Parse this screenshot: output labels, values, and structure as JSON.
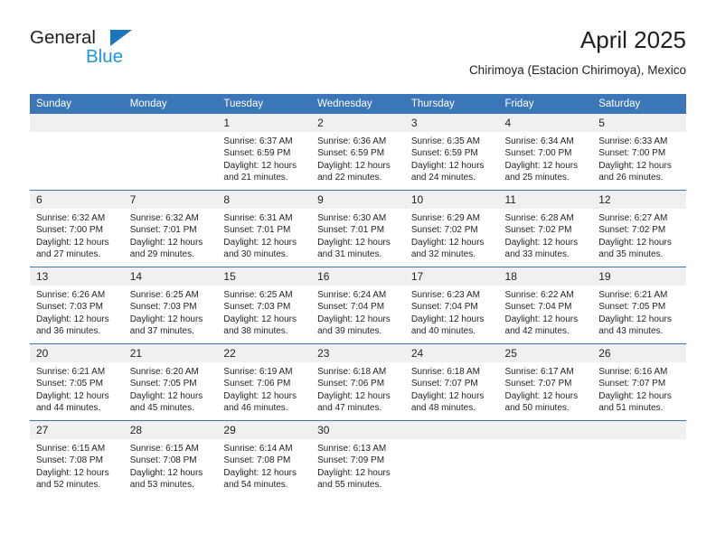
{
  "brand": {
    "name_part1": "General",
    "name_part2": "Blue",
    "accent_color": "#1b75bb",
    "accent_color_light": "#1b9ad6"
  },
  "header": {
    "month_title": "April 2025",
    "location": "Chirimoya (Estacion Chirimoya), Mexico"
  },
  "theme": {
    "header_blue": "#3b76b8",
    "daynum_band": "#f0f0f0"
  },
  "calendar": {
    "weekday_headers": [
      "Sunday",
      "Monday",
      "Tuesday",
      "Wednesday",
      "Thursday",
      "Friday",
      "Saturday"
    ],
    "weeks": [
      [
        {
          "day": "",
          "empty": true,
          "sunrise": "",
          "sunset": "",
          "daylight_line1": "",
          "daylight_line2": ""
        },
        {
          "day": "",
          "empty": true,
          "sunrise": "",
          "sunset": "",
          "daylight_line1": "",
          "daylight_line2": ""
        },
        {
          "day": "1",
          "sunrise": "Sunrise: 6:37 AM",
          "sunset": "Sunset: 6:59 PM",
          "daylight_line1": "Daylight: 12 hours",
          "daylight_line2": "and 21 minutes."
        },
        {
          "day": "2",
          "sunrise": "Sunrise: 6:36 AM",
          "sunset": "Sunset: 6:59 PM",
          "daylight_line1": "Daylight: 12 hours",
          "daylight_line2": "and 22 minutes."
        },
        {
          "day": "3",
          "sunrise": "Sunrise: 6:35 AM",
          "sunset": "Sunset: 6:59 PM",
          "daylight_line1": "Daylight: 12 hours",
          "daylight_line2": "and 24 minutes."
        },
        {
          "day": "4",
          "sunrise": "Sunrise: 6:34 AM",
          "sunset": "Sunset: 7:00 PM",
          "daylight_line1": "Daylight: 12 hours",
          "daylight_line2": "and 25 minutes."
        },
        {
          "day": "5",
          "sunrise": "Sunrise: 6:33 AM",
          "sunset": "Sunset: 7:00 PM",
          "daylight_line1": "Daylight: 12 hours",
          "daylight_line2": "and 26 minutes."
        }
      ],
      [
        {
          "day": "6",
          "sunrise": "Sunrise: 6:32 AM",
          "sunset": "Sunset: 7:00 PM",
          "daylight_line1": "Daylight: 12 hours",
          "daylight_line2": "and 27 minutes."
        },
        {
          "day": "7",
          "sunrise": "Sunrise: 6:32 AM",
          "sunset": "Sunset: 7:01 PM",
          "daylight_line1": "Daylight: 12 hours",
          "daylight_line2": "and 29 minutes."
        },
        {
          "day": "8",
          "sunrise": "Sunrise: 6:31 AM",
          "sunset": "Sunset: 7:01 PM",
          "daylight_line1": "Daylight: 12 hours",
          "daylight_line2": "and 30 minutes."
        },
        {
          "day": "9",
          "sunrise": "Sunrise: 6:30 AM",
          "sunset": "Sunset: 7:01 PM",
          "daylight_line1": "Daylight: 12 hours",
          "daylight_line2": "and 31 minutes."
        },
        {
          "day": "10",
          "sunrise": "Sunrise: 6:29 AM",
          "sunset": "Sunset: 7:02 PM",
          "daylight_line1": "Daylight: 12 hours",
          "daylight_line2": "and 32 minutes."
        },
        {
          "day": "11",
          "sunrise": "Sunrise: 6:28 AM",
          "sunset": "Sunset: 7:02 PM",
          "daylight_line1": "Daylight: 12 hours",
          "daylight_line2": "and 33 minutes."
        },
        {
          "day": "12",
          "sunrise": "Sunrise: 6:27 AM",
          "sunset": "Sunset: 7:02 PM",
          "daylight_line1": "Daylight: 12 hours",
          "daylight_line2": "and 35 minutes."
        }
      ],
      [
        {
          "day": "13",
          "sunrise": "Sunrise: 6:26 AM",
          "sunset": "Sunset: 7:03 PM",
          "daylight_line1": "Daylight: 12 hours",
          "daylight_line2": "and 36 minutes."
        },
        {
          "day": "14",
          "sunrise": "Sunrise: 6:25 AM",
          "sunset": "Sunset: 7:03 PM",
          "daylight_line1": "Daylight: 12 hours",
          "daylight_line2": "and 37 minutes."
        },
        {
          "day": "15",
          "sunrise": "Sunrise: 6:25 AM",
          "sunset": "Sunset: 7:03 PM",
          "daylight_line1": "Daylight: 12 hours",
          "daylight_line2": "and 38 minutes."
        },
        {
          "day": "16",
          "sunrise": "Sunrise: 6:24 AM",
          "sunset": "Sunset: 7:04 PM",
          "daylight_line1": "Daylight: 12 hours",
          "daylight_line2": "and 39 minutes."
        },
        {
          "day": "17",
          "sunrise": "Sunrise: 6:23 AM",
          "sunset": "Sunset: 7:04 PM",
          "daylight_line1": "Daylight: 12 hours",
          "daylight_line2": "and 40 minutes."
        },
        {
          "day": "18",
          "sunrise": "Sunrise: 6:22 AM",
          "sunset": "Sunset: 7:04 PM",
          "daylight_line1": "Daylight: 12 hours",
          "daylight_line2": "and 42 minutes."
        },
        {
          "day": "19",
          "sunrise": "Sunrise: 6:21 AM",
          "sunset": "Sunset: 7:05 PM",
          "daylight_line1": "Daylight: 12 hours",
          "daylight_line2": "and 43 minutes."
        }
      ],
      [
        {
          "day": "20",
          "sunrise": "Sunrise: 6:21 AM",
          "sunset": "Sunset: 7:05 PM",
          "daylight_line1": "Daylight: 12 hours",
          "daylight_line2": "and 44 minutes."
        },
        {
          "day": "21",
          "sunrise": "Sunrise: 6:20 AM",
          "sunset": "Sunset: 7:05 PM",
          "daylight_line1": "Daylight: 12 hours",
          "daylight_line2": "and 45 minutes."
        },
        {
          "day": "22",
          "sunrise": "Sunrise: 6:19 AM",
          "sunset": "Sunset: 7:06 PM",
          "daylight_line1": "Daylight: 12 hours",
          "daylight_line2": "and 46 minutes."
        },
        {
          "day": "23",
          "sunrise": "Sunrise: 6:18 AM",
          "sunset": "Sunset: 7:06 PM",
          "daylight_line1": "Daylight: 12 hours",
          "daylight_line2": "and 47 minutes."
        },
        {
          "day": "24",
          "sunrise": "Sunrise: 6:18 AM",
          "sunset": "Sunset: 7:07 PM",
          "daylight_line1": "Daylight: 12 hours",
          "daylight_line2": "and 48 minutes."
        },
        {
          "day": "25",
          "sunrise": "Sunrise: 6:17 AM",
          "sunset": "Sunset: 7:07 PM",
          "daylight_line1": "Daylight: 12 hours",
          "daylight_line2": "and 50 minutes."
        },
        {
          "day": "26",
          "sunrise": "Sunrise: 6:16 AM",
          "sunset": "Sunset: 7:07 PM",
          "daylight_line1": "Daylight: 12 hours",
          "daylight_line2": "and 51 minutes."
        }
      ],
      [
        {
          "day": "27",
          "sunrise": "Sunrise: 6:15 AM",
          "sunset": "Sunset: 7:08 PM",
          "daylight_line1": "Daylight: 12 hours",
          "daylight_line2": "and 52 minutes."
        },
        {
          "day": "28",
          "sunrise": "Sunrise: 6:15 AM",
          "sunset": "Sunset: 7:08 PM",
          "daylight_line1": "Daylight: 12 hours",
          "daylight_line2": "and 53 minutes."
        },
        {
          "day": "29",
          "sunrise": "Sunrise: 6:14 AM",
          "sunset": "Sunset: 7:08 PM",
          "daylight_line1": "Daylight: 12 hours",
          "daylight_line2": "and 54 minutes."
        },
        {
          "day": "30",
          "sunrise": "Sunrise: 6:13 AM",
          "sunset": "Sunset: 7:09 PM",
          "daylight_line1": "Daylight: 12 hours",
          "daylight_line2": "and 55 minutes."
        },
        {
          "day": "",
          "empty": true,
          "sunrise": "",
          "sunset": "",
          "daylight_line1": "",
          "daylight_line2": ""
        },
        {
          "day": "",
          "empty": true,
          "sunrise": "",
          "sunset": "",
          "daylight_line1": "",
          "daylight_line2": ""
        },
        {
          "day": "",
          "empty": true,
          "sunrise": "",
          "sunset": "",
          "daylight_line1": "",
          "daylight_line2": ""
        }
      ]
    ]
  }
}
